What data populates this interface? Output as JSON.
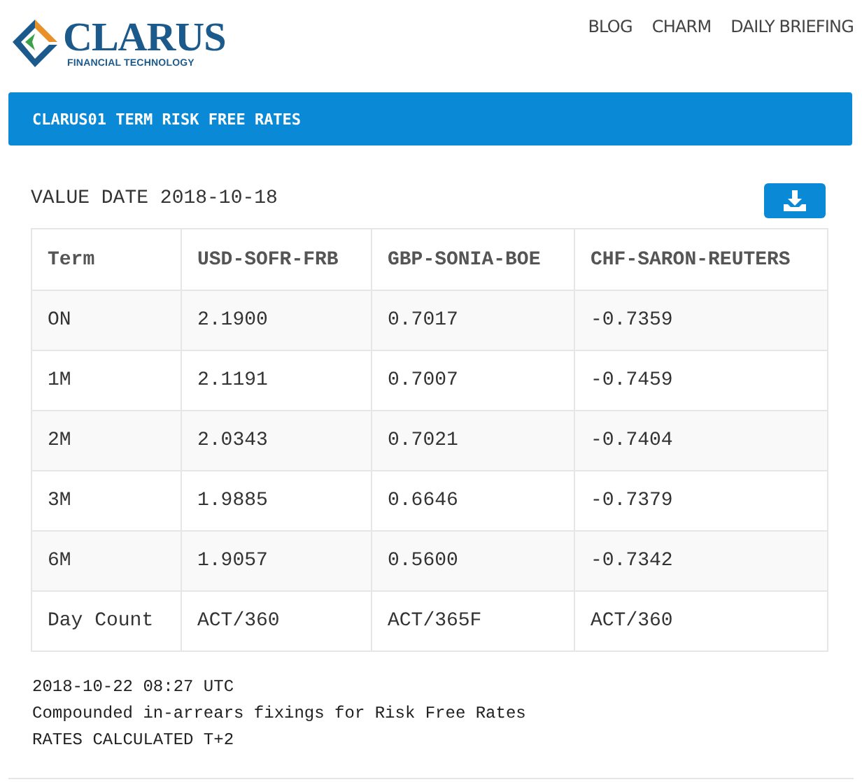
{
  "logo": {
    "name": "CLARUS",
    "tagline": "FINANCIAL TECHNOLOGY"
  },
  "nav": [
    "BLOG",
    "CHARM",
    "DAILY BRIEFING"
  ],
  "banner": {
    "title": "CLARUS01 TERM RISK FREE RATES"
  },
  "value_date": "VALUE DATE 2018-10-18",
  "table": {
    "columns": [
      "Term",
      "USD-SOFR-FRB",
      "GBP-SONIA-BOE",
      "CHF-SARON-REUTERS"
    ],
    "rows": [
      [
        "ON",
        "2.1900",
        "0.7017",
        "-0.7359"
      ],
      [
        "1M",
        "2.1191",
        "0.7007",
        "-0.7459"
      ],
      [
        "2M",
        "2.0343",
        "0.7021",
        "-0.7404"
      ],
      [
        "3M",
        "1.9885",
        "0.6646",
        "-0.7379"
      ],
      [
        "6M",
        "1.9057",
        "0.5600",
        "-0.7342"
      ],
      [
        "Day Count",
        "ACT/360",
        "ACT/365F",
        "ACT/360"
      ]
    ]
  },
  "notes": [
    "2018-10-22 08:27 UTC",
    "Compounded in-arrears fixings for Risk Free Rates",
    "RATES CALCULATED T+2"
  ]
}
